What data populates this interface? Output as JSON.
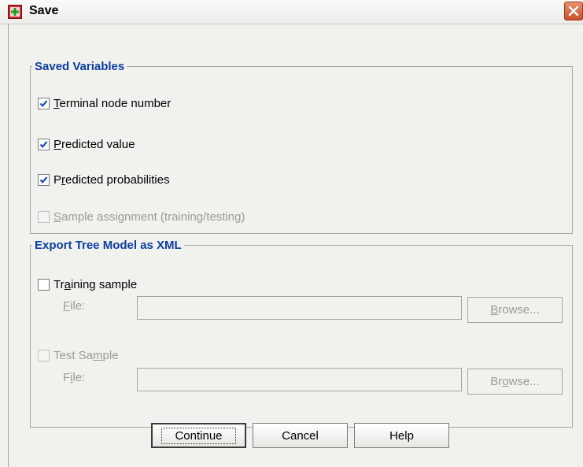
{
  "window": {
    "title": "Save"
  },
  "saved_variables": {
    "legend": "Saved Variables",
    "items": [
      {
        "pre": "",
        "mnemonic": "T",
        "post": "erminal node number",
        "checked": true,
        "enabled": true
      },
      {
        "pre": "",
        "mnemonic": "P",
        "post": "redicted value",
        "checked": true,
        "enabled": true
      },
      {
        "pre": "P",
        "mnemonic": "r",
        "post": "edicted probabilities",
        "checked": true,
        "enabled": true
      },
      {
        "pre": "",
        "mnemonic": "S",
        "post": "ample assignment (training/testing)",
        "checked": false,
        "enabled": false
      }
    ]
  },
  "export": {
    "legend": "Export Tree Model as XML",
    "training": {
      "pre": "Tr",
      "mnemonic": "a",
      "post": "ining sample",
      "checked": false,
      "file_pre": "",
      "file_mn": "F",
      "file_post": "ile:",
      "file_value": "",
      "browse_pre": "",
      "browse_mn": "B",
      "browse_post": "rowse..."
    },
    "test": {
      "pre": "Test Sa",
      "mnemonic": "m",
      "post": "ple",
      "checked": false,
      "file_pre": "F",
      "file_mn": "i",
      "file_post": "le:",
      "file_value": "",
      "browse_pre": "Br",
      "browse_mn": "o",
      "browse_post": "wse..."
    }
  },
  "buttons": {
    "continue": "Continue",
    "cancel": "Cancel",
    "help": "Help"
  }
}
